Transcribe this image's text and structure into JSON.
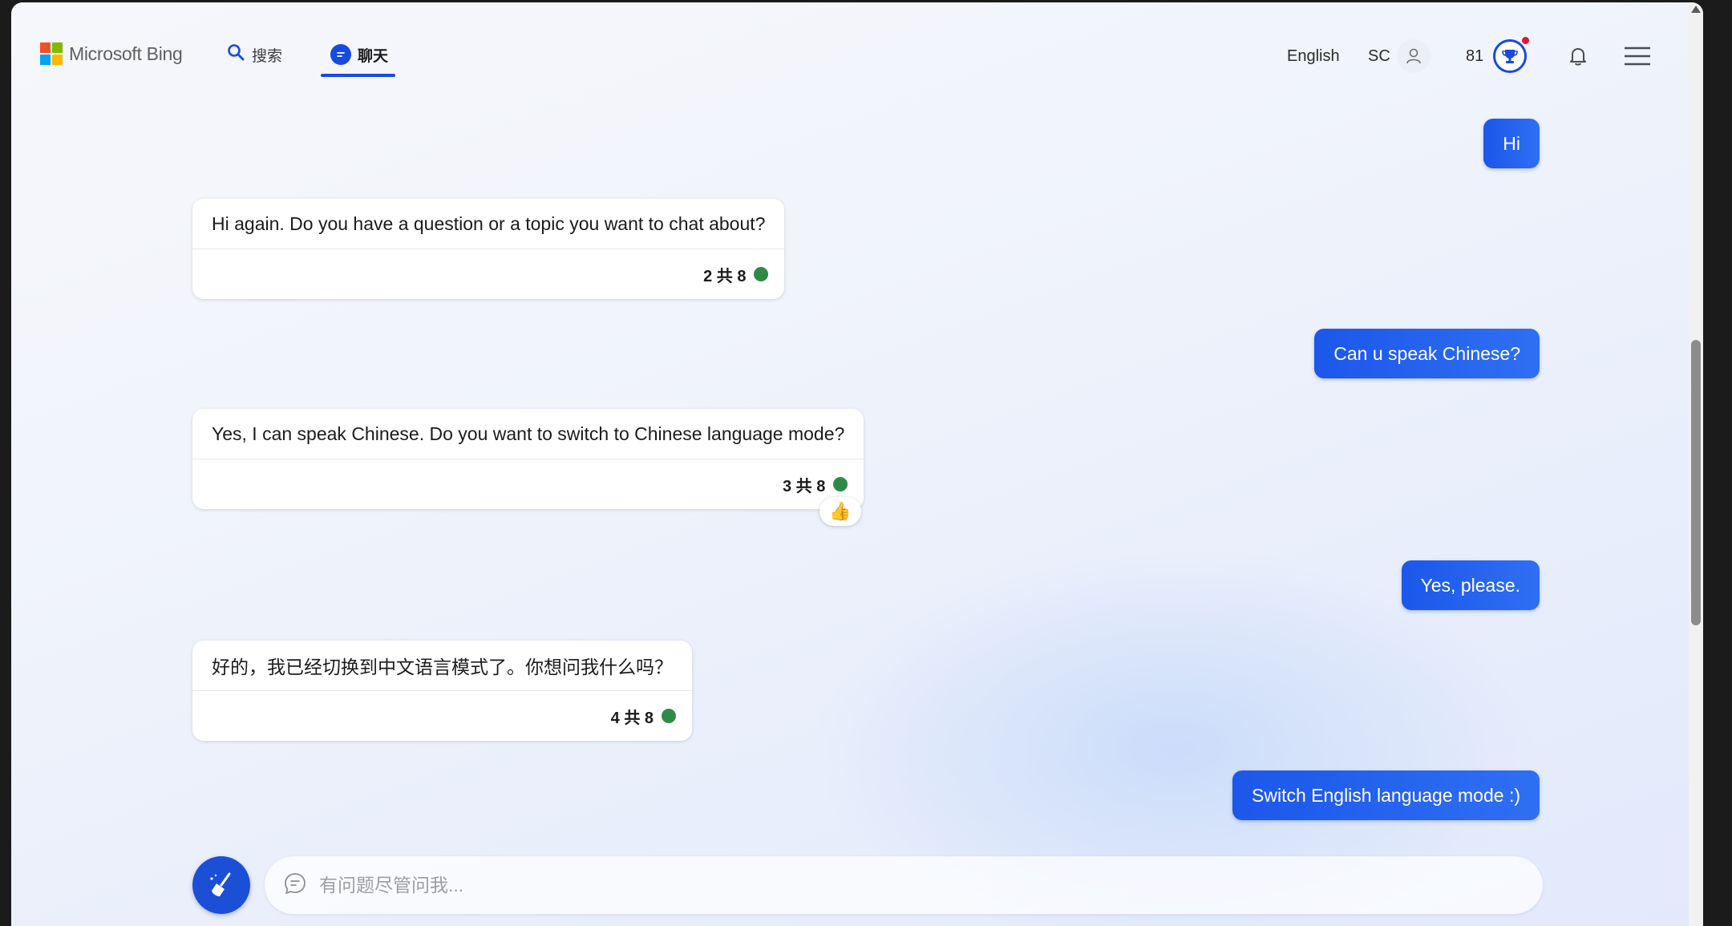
{
  "header": {
    "logo_text": "Microsoft Bing",
    "tabs": [
      {
        "label": "搜索",
        "icon": "search-icon",
        "active": false
      },
      {
        "label": "聊天",
        "icon": "chat-bubble-icon",
        "active": true
      }
    ],
    "language": "English",
    "user_initials": "SC",
    "points": "81"
  },
  "chat": {
    "messages": [
      {
        "role": "user",
        "text": "Hi"
      },
      {
        "role": "bot",
        "text": "Hi again. Do you have a question or a topic you want to chat about?",
        "counter": "2 共 8"
      },
      {
        "role": "user",
        "text": "Can u speak Chinese?"
      },
      {
        "role": "bot",
        "text": "Yes, I can speak Chinese. Do you want to switch to Chinese language mode?",
        "counter": "3 共 8",
        "reaction": "👍"
      },
      {
        "role": "user",
        "text": "Yes, please."
      },
      {
        "role": "bot",
        "text": "好的，我已经切换到中文语言模式了。你想问我什么吗？",
        "counter": "4 共 8"
      },
      {
        "role": "user",
        "text": "Switch English language mode :)"
      }
    ]
  },
  "composer": {
    "placeholder": "有问题尽管问我...",
    "value": ""
  },
  "colors": {
    "accent": "#174ae4",
    "user_bubble": "#1c57ea",
    "status_green": "#2e8b45",
    "notification_red": "#e2162a",
    "ms_logo": [
      "#f25022",
      "#7fba00",
      "#00a4ef",
      "#ffb900"
    ]
  }
}
